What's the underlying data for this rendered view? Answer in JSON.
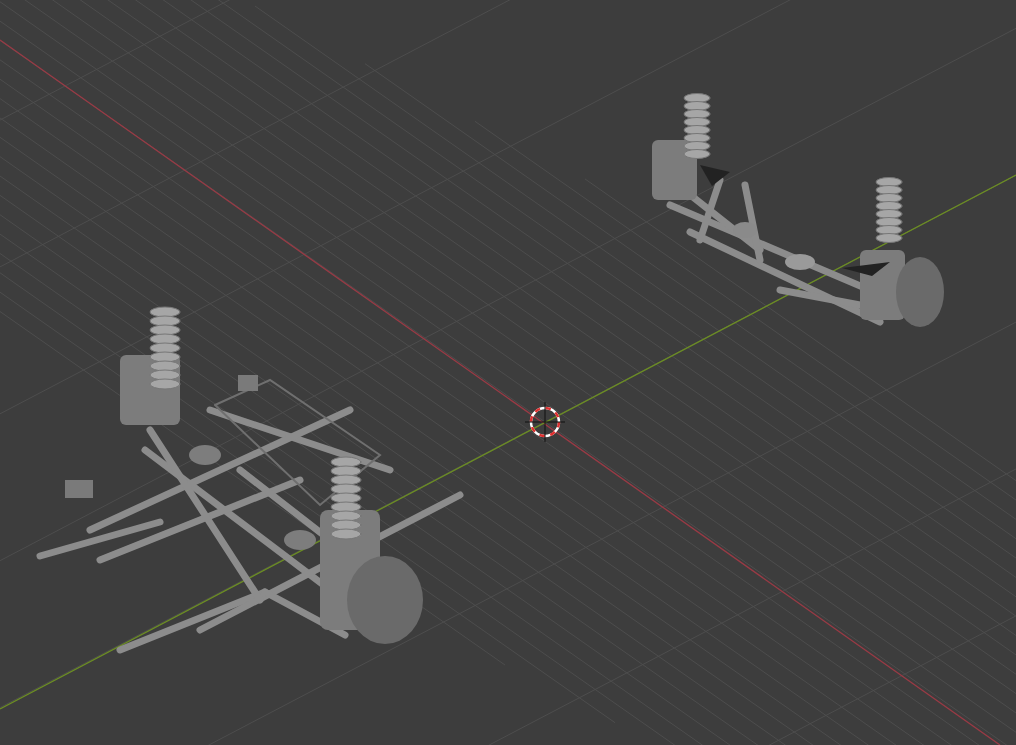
{
  "viewport": {
    "objects": [
      {
        "kind": "front_suspension"
      },
      {
        "kind": "rear_suspension"
      }
    ]
  }
}
